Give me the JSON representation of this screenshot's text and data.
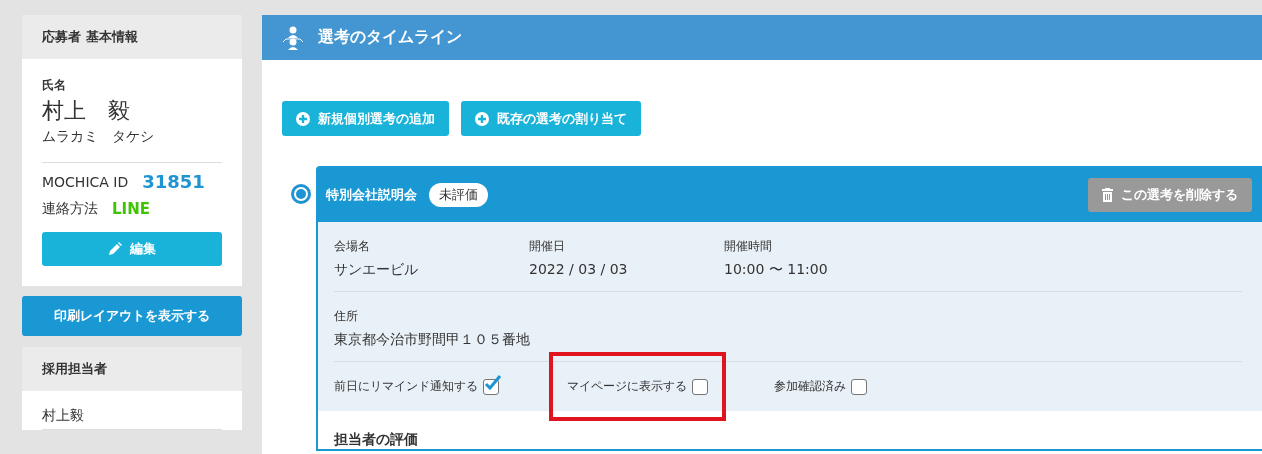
{
  "applicant": {
    "title": "応募者 基本情報",
    "name_label": "氏名",
    "name": "村上　毅",
    "kana": "ムラカミ　タケシ",
    "id_label": "MOCHICA ID",
    "id": "31851",
    "contact_label": "連絡方法",
    "contact": "LINE",
    "edit_button": "編集"
  },
  "print_button": "印刷レイアウトを表示する",
  "recruiter": {
    "title": "採用担当者",
    "name": "村上毅"
  },
  "timeline": {
    "title": "選考のタイムライン",
    "buttons": [
      "新規個別選考の追加",
      "既存の選考の割り当て"
    ],
    "stage": {
      "name": "特別会社説明会",
      "status": "未評価",
      "delete_button": "この選考を削除する",
      "fields": [
        {
          "label": "会場名",
          "value": "サンエービル"
        },
        {
          "label": "開催日",
          "value": "2022 / 03 / 03"
        },
        {
          "label": "開催時間",
          "value": "10:00 〜 11:00"
        }
      ],
      "address_label": "住所",
      "address": "東京都今治市野間甲１０５番地",
      "checks": [
        {
          "label": "前日にリマインド通知する",
          "checked": true,
          "highlighted": false
        },
        {
          "label": "マイページに表示する",
          "checked": false,
          "highlighted": true
        },
        {
          "label": "参加確認済み",
          "checked": false,
          "highlighted": false
        }
      ],
      "evaluation_title": "担当者の評価"
    }
  }
}
